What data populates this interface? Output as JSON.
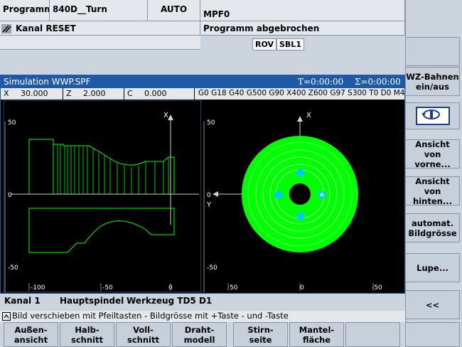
{
  "header": {
    "area": "Programm",
    "machine": "840D__Turn",
    "mode": "AUTO",
    "program": "MPF0",
    "channel_status": "Kanal RESET",
    "program_status": "Programm abgebrochen",
    "flags": [
      "ROV",
      "SBL1"
    ]
  },
  "simulation": {
    "title": "Simulation  WWP.SPF",
    "time_t": "T=0:00:00",
    "time_sum": "Σ=0:00:00",
    "x_label": "X",
    "x_value": "30.000",
    "z_label": "Z",
    "z_value": "2.000",
    "c_label": "C",
    "c_value": "0.000",
    "gcodes": "G0 G18 G40 G500 G90 X400 Z600 G97 S300 T0 D0 M4",
    "left_view": {
      "axis_x": "X",
      "ticks_y": [
        "50",
        "0",
        "-50"
      ],
      "ticks_x": [
        "-100",
        "-50",
        "0"
      ]
    },
    "right_view": {
      "axis_x": "X",
      "axis_y": "Y",
      "ticks_y": [
        "50",
        "0",
        "-50"
      ],
      "ticks_x": [
        "50",
        "0",
        "-50"
      ]
    }
  },
  "status": {
    "channel": "Kanal 1",
    "spindle": "Hauptspindel",
    "tool": "Werkzeug TD5 D1"
  },
  "hint": "Bild verschieben mit Pfeiltasten - Bildgrösse mit +Taste - und -Taste",
  "right_softkeys": [
    {
      "label": ""
    },
    {
      "label": "WZ-Bahnen\nein/aus"
    },
    {
      "label": ""
    },
    {
      "label": "Ansicht von\nvorne..."
    },
    {
      "label": "Ansicht von\nhinten..."
    },
    {
      "label": "automat.\nBildgrösse"
    },
    {
      "label": "Lupe..."
    },
    {
      "label": "<<"
    }
  ],
  "bottom_softkeys": [
    {
      "label": "Außen-\nansicht"
    },
    {
      "label": "Halb-\nschnitt"
    },
    {
      "label": "Voll-\nschnitt"
    },
    {
      "label": "Draht-\nmodell"
    },
    {
      "label": "Stirn-\nseite"
    },
    {
      "label": "Mantel-\nfläche"
    },
    {
      "label": ""
    },
    {
      "label": ""
    }
  ],
  "colors": {
    "sim_title_bar": "#1f5aa6",
    "canvas": "#000000",
    "part": "#00ff00",
    "hole": "#00c8ff"
  }
}
